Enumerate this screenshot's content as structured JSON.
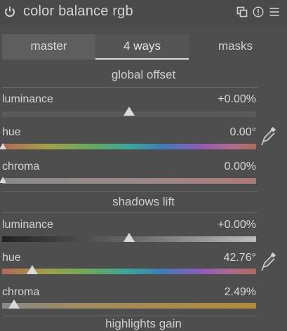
{
  "module": {
    "title": "color balance rgb",
    "icons": [
      "power-icon",
      "presets-icon",
      "reset-icon",
      "menu-icon"
    ]
  },
  "tabs": [
    {
      "label": "master"
    },
    {
      "label": "4 ways"
    },
    {
      "label": "masks"
    }
  ],
  "global_offset": {
    "title": "global offset",
    "luminance": {
      "label": "luminance",
      "value": "+0.00%",
      "position": 0.5
    },
    "hue": {
      "label": "hue",
      "value": "0.00°",
      "position": 0.0
    },
    "chroma": {
      "label": "chroma",
      "value": "0.00%",
      "position": 0.0
    }
  },
  "shadows_lift": {
    "title": "shadows lift",
    "luminance": {
      "label": "luminance",
      "value": "+0.00%",
      "position": 0.5
    },
    "hue": {
      "label": "hue",
      "value": "42.76°",
      "position": 0.12
    },
    "chroma": {
      "label": "chroma",
      "value": "2.49%",
      "position": 0.05
    }
  },
  "highlights_gain": {
    "title": "highlights gain"
  },
  "colors": {
    "background": "#4e4e4e",
    "text": "#d6d6d6",
    "tab_active_underline": "#d9d9d9"
  }
}
